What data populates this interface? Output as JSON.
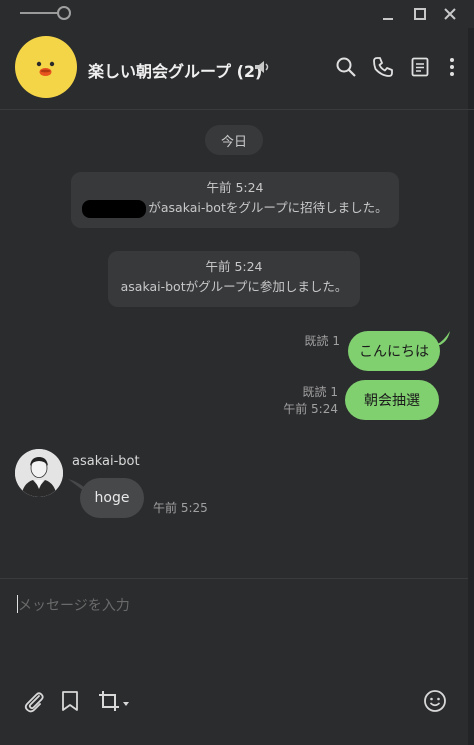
{
  "window": {
    "minimize_icon": "minimize-icon",
    "maximize_icon": "maximize-icon",
    "close_icon": "close-icon"
  },
  "header": {
    "title": "楽しい朝会グループ (2)",
    "group_avatar_color": "#f5d548"
  },
  "day_separator": "今日",
  "system_messages": [
    {
      "time": "午前 5:24",
      "text": "がasakai-botをグループに招待しました。"
    },
    {
      "time": "午前 5:24",
      "text": "asakai-botがグループに参加しました。"
    }
  ],
  "my_messages": [
    {
      "read": "既読 1",
      "time": "",
      "text": "こんにちは"
    },
    {
      "read": "既読 1",
      "time": "午前 5:24",
      "text": "朝会抽選"
    }
  ],
  "other_message": {
    "sender": "asakai-bot",
    "text": "hoge",
    "time": "午前 5:25"
  },
  "input": {
    "placeholder": "メッセージを入力"
  },
  "colors": {
    "background": "#2b2c2e",
    "my_bubble": "#80d070",
    "other_bubble": "#47484a"
  }
}
